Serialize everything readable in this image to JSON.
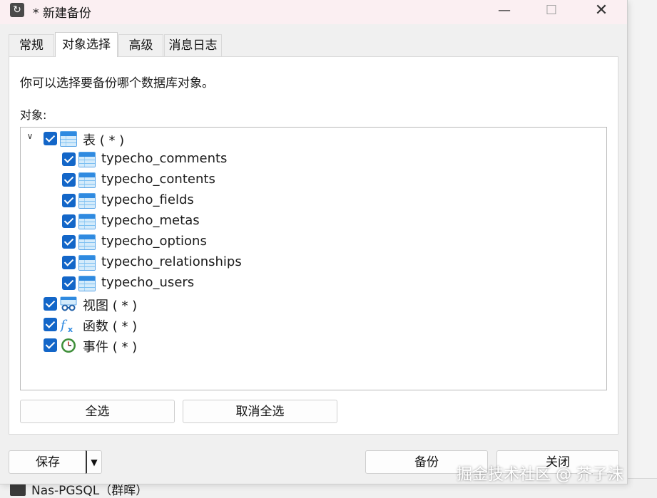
{
  "window": {
    "title": "* 新建备份",
    "app_icon": "refresh-icon",
    "controls": {
      "minimize": "—",
      "maximize": "☐",
      "close": "✕"
    }
  },
  "tabs": [
    {
      "label": "常规"
    },
    {
      "label": "对象选择",
      "active": true
    },
    {
      "label": "高级"
    },
    {
      "label": "消息日志"
    }
  ],
  "panel": {
    "description": "你可以选择要备份哪个数据库对象。",
    "objects_label": "对象:"
  },
  "tree": {
    "tables": {
      "label": "表 ( * )",
      "expanded": true,
      "checked": true,
      "icon": "table-icon",
      "children": [
        {
          "label": "typecho_comments",
          "checked": true
        },
        {
          "label": "typecho_contents",
          "checked": true
        },
        {
          "label": "typecho_fields",
          "checked": true
        },
        {
          "label": "typecho_metas",
          "checked": true
        },
        {
          "label": "typecho_options",
          "checked": true
        },
        {
          "label": "typecho_relationships",
          "checked": true
        },
        {
          "label": "typecho_users",
          "checked": true
        }
      ]
    },
    "views": {
      "label": "视图 ( * )",
      "checked": true,
      "icon": "view-icon"
    },
    "functions": {
      "label": "函数 ( * )",
      "checked": true,
      "icon": "function-icon"
    },
    "events": {
      "label": "事件 ( * )",
      "checked": true,
      "icon": "clock-icon"
    }
  },
  "buttons": {
    "select_all": "全选",
    "deselect_all": "取消全选",
    "save": "保存",
    "backup": "备份",
    "close": "关闭"
  },
  "background": {
    "taskbar_app": "Nas-PGSQL（群晖）"
  },
  "watermark": "掘金技术社区 @ 芥子沫",
  "colors": {
    "checkbox": "#1366c8",
    "titlebar": "#fbeff2"
  }
}
